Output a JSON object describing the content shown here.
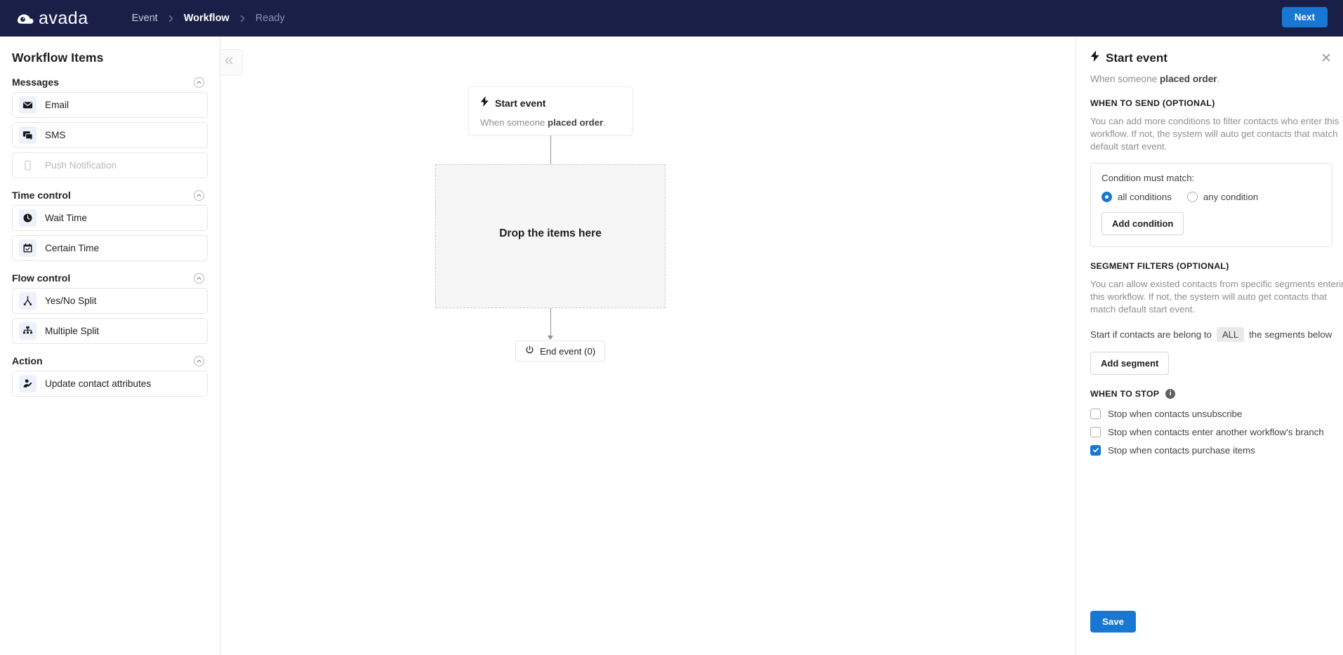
{
  "header": {
    "brand": "avada",
    "brand_icon": "avada-cloud-logo",
    "breadcrumb": [
      {
        "label": "Event",
        "state": "link"
      },
      {
        "label": "Workflow",
        "state": "current"
      },
      {
        "label": "Ready",
        "state": "muted"
      }
    ],
    "next_label": "Next"
  },
  "sidebar": {
    "title": "Workflow Items",
    "collapse_icon": "chevron-up-circle-icon",
    "groups": [
      {
        "name": "Messages",
        "items": [
          {
            "label": "Email",
            "icon": "envelope-icon",
            "disabled": false
          },
          {
            "label": "SMS",
            "icon": "chat-bubbles-icon",
            "disabled": false
          },
          {
            "label": "Push Notification",
            "icon": "mobile-phone-icon",
            "disabled": true
          }
        ]
      },
      {
        "name": "Time control",
        "items": [
          {
            "label": "Wait Time",
            "icon": "clock-icon",
            "disabled": false
          },
          {
            "label": "Certain Time",
            "icon": "calendar-check-icon",
            "disabled": false
          }
        ]
      },
      {
        "name": "Flow control",
        "items": [
          {
            "label": "Yes/No Split",
            "icon": "branch-split-icon",
            "disabled": false
          },
          {
            "label": "Multiple Split",
            "icon": "hierarchy-split-icon",
            "disabled": false
          }
        ]
      },
      {
        "name": "Action",
        "items": [
          {
            "label": "Update contact attributes",
            "icon": "user-edit-icon",
            "disabled": false
          }
        ]
      }
    ]
  },
  "canvas": {
    "collapse_icon": "double-chevron-left-icon",
    "start_node": {
      "icon": "lightning-bolt-icon",
      "title": "Start event",
      "subtitle_prefix": "When someone ",
      "subtitle_bold": "placed order",
      "subtitle_suffix": "."
    },
    "dropzone_label": "Drop the items here",
    "end_node": {
      "icon": "power-icon",
      "label": "End event (0)"
    }
  },
  "panel": {
    "icon": "lightning-bolt-icon",
    "title": "Start event",
    "close_icon": "close-icon",
    "subtitle_prefix": "When someone ",
    "subtitle_bold": "placed order",
    "subtitle_suffix": ".",
    "when_to_send": {
      "label": "WHEN TO SEND (OPTIONAL)",
      "description": "You can add more conditions to filter contacts who enter this workflow. If not, the system will auto get contacts that match default start event.",
      "condition_title": "Condition must match:",
      "options": [
        {
          "label": "all conditions",
          "selected": true
        },
        {
          "label": "any condition",
          "selected": false
        }
      ],
      "add_condition_label": "Add condition"
    },
    "segment_filters": {
      "label": "SEGMENT FILTERS (OPTIONAL)",
      "description": "You can allow existed contacts from specific segments entering this workflow. If not, the system will auto get contacts that match default start event.",
      "sentence_prefix": "Start if contacts are belong to",
      "sentence_pill": "ALL",
      "sentence_suffix": "the segments below",
      "add_segment_label": "Add segment"
    },
    "when_to_stop": {
      "label": "WHEN TO STOP",
      "info_icon": "info-icon",
      "info_char": "i",
      "checkboxes": [
        {
          "label": "Stop when contacts unsubscribe",
          "checked": false
        },
        {
          "label": "Stop when contacts enter another workflow's branch",
          "checked": false
        },
        {
          "label": "Stop when contacts purchase items",
          "checked": true
        }
      ]
    },
    "save_label": "Save"
  },
  "colors": {
    "topbar": "#1a1f48",
    "accent": "#1877d2",
    "icon_tile": "#eef0fb"
  }
}
